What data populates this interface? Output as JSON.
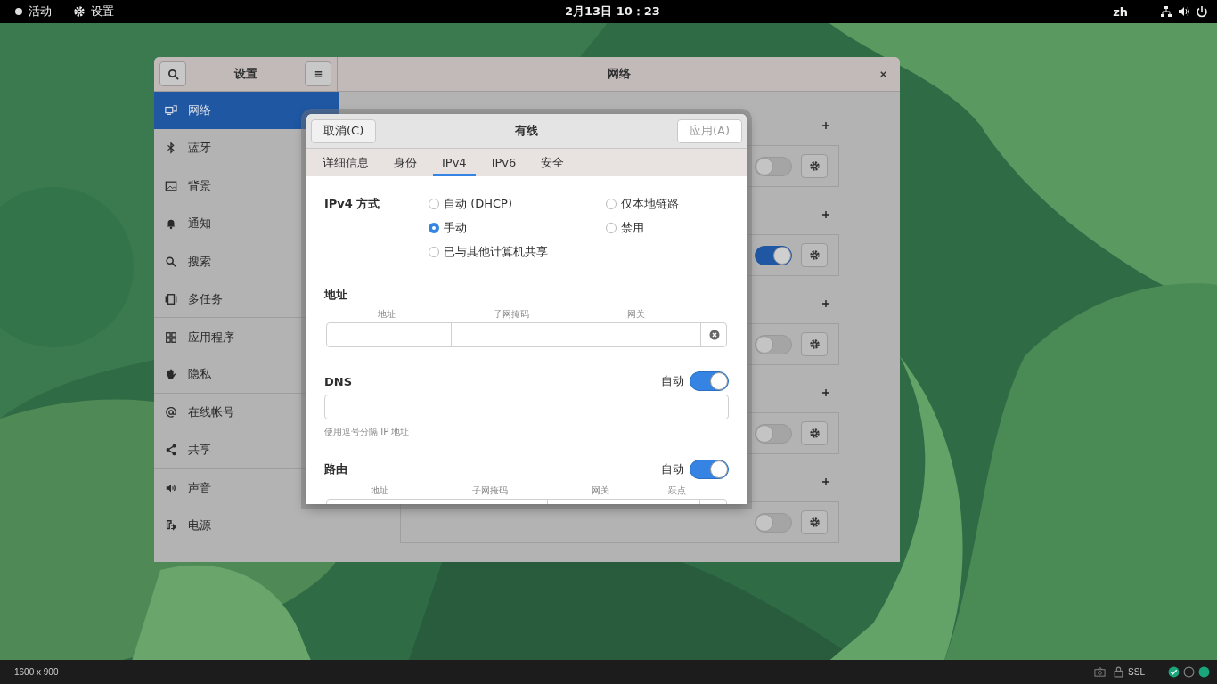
{
  "top_bar": {
    "activities": "活动",
    "app_menu": "设置",
    "clock": "2月13日  10：23",
    "input_method": "zh"
  },
  "settings": {
    "sidebar_title": "设置",
    "title": "网络",
    "sidebar": [
      {
        "label": "网络",
        "selected": true
      },
      {
        "label": "蓝牙",
        "selected": false
      },
      {
        "label": "背景",
        "selected": false
      },
      {
        "label": "通知",
        "selected": false
      },
      {
        "label": "搜索",
        "selected": false
      },
      {
        "label": "多任务",
        "selected": false
      },
      {
        "label": "应用程序",
        "selected": false
      },
      {
        "label": "隐私",
        "selected": false
      },
      {
        "label": "在线帐号",
        "selected": false
      },
      {
        "label": "共享",
        "selected": false
      },
      {
        "label": "声音",
        "selected": false
      },
      {
        "label": "电源",
        "selected": false
      }
    ],
    "sections": [
      {
        "on": false
      },
      {
        "on": true
      },
      {
        "on": false
      },
      {
        "on": false
      },
      {
        "on": false
      }
    ]
  },
  "dialog": {
    "cancel": "取消(C)",
    "title": "有线",
    "apply": "应用(A)",
    "apply_disabled": true,
    "tabs": [
      {
        "label": "详细信息",
        "selected": false
      },
      {
        "label": "身份",
        "selected": false
      },
      {
        "label": "IPv4",
        "selected": true
      },
      {
        "label": "IPv6",
        "selected": false
      },
      {
        "label": "安全",
        "selected": false
      }
    ],
    "method_label": "IPv4 方式",
    "methods": [
      {
        "label": "自动 (DHCP)",
        "selected": false
      },
      {
        "label": "仅本地链路",
        "selected": false
      },
      {
        "label": "手动",
        "selected": true
      },
      {
        "label": "禁用",
        "selected": false
      },
      {
        "label": "已与其他计算机共享",
        "selected": false
      }
    ],
    "address": {
      "title": "地址",
      "columns": [
        "地址",
        "子网掩码",
        "网关"
      ]
    },
    "dns": {
      "title": "DNS",
      "auto_label": "自动",
      "auto": true,
      "hint": "使用逗号分隔 IP 地址"
    },
    "routes": {
      "title": "路由",
      "auto_label": "自动",
      "auto": true,
      "columns": [
        "地址",
        "子网掩码",
        "网关",
        "跃点"
      ]
    }
  },
  "status_bar": {
    "resolution": "1600 x 900",
    "ssl": "SSL"
  }
}
